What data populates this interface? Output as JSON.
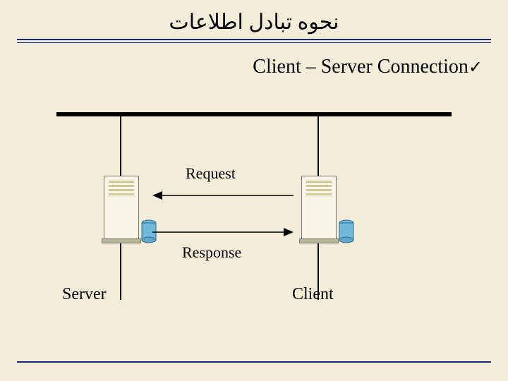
{
  "title": "نحوه تبادل اطلاعات",
  "subtitle": "Client – Server Connection",
  "checkmark": "✓",
  "labels": {
    "request": "Request",
    "response": "Response",
    "server": "Server",
    "client": "Client"
  }
}
